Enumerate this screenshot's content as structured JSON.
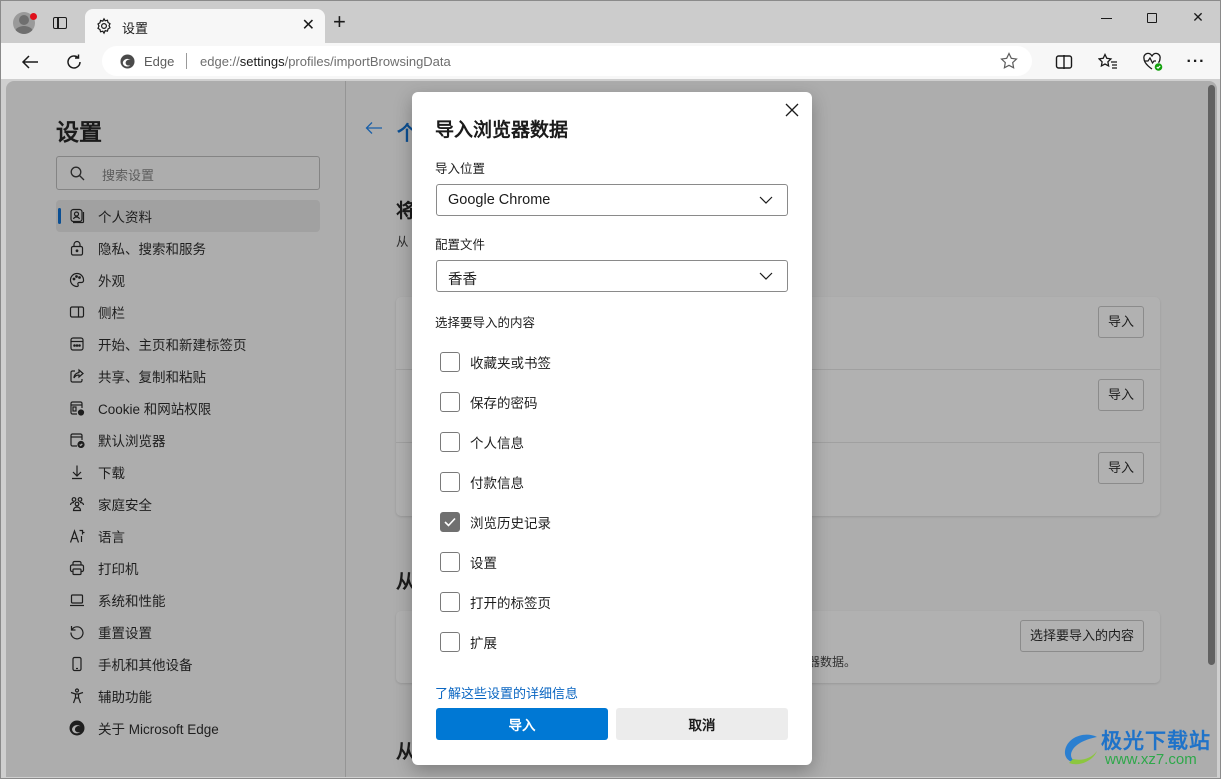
{
  "browser": {
    "tab_title": "设置",
    "address_label": "Edge",
    "url_prefix": "edge://",
    "url_host": "settings",
    "url_path": "/profiles/importBrowsingData",
    "profile_badge_color": "#e0101b"
  },
  "sidebar": {
    "title": "设置",
    "search_placeholder": "搜索设置",
    "items": [
      {
        "label": "个人资料",
        "icon": "profile-icon",
        "active": true
      },
      {
        "label": "隐私、搜索和服务",
        "icon": "lock-icon"
      },
      {
        "label": "外观",
        "icon": "palette-icon"
      },
      {
        "label": "侧栏",
        "icon": "sidebar-icon"
      },
      {
        "label": "开始、主页和新建标签页",
        "icon": "home-page-icon"
      },
      {
        "label": "共享、复制和粘贴",
        "icon": "share-icon"
      },
      {
        "label": "Cookie 和网站权限",
        "icon": "site-permissions-icon"
      },
      {
        "label": "默认浏览器",
        "icon": "default-browser-icon"
      },
      {
        "label": "下载",
        "icon": "download-icon"
      },
      {
        "label": "家庭安全",
        "icon": "family-icon"
      },
      {
        "label": "语言",
        "icon": "language-icon"
      },
      {
        "label": "打印机",
        "icon": "printer-icon"
      },
      {
        "label": "系统和性能",
        "icon": "laptop-icon"
      },
      {
        "label": "重置设置",
        "icon": "reset-icon"
      },
      {
        "label": "手机和其他设备",
        "icon": "phone-icon"
      },
      {
        "label": "辅助功能",
        "icon": "accessibility-icon"
      },
      {
        "label": "关于 Microsoft Edge",
        "icon": "edge-logo-icon"
      }
    ]
  },
  "content": {
    "title_partial": "个",
    "section1_heading_partial": "将",
    "section1_sub_partial": "从",
    "import_buttons": [
      "导入",
      "导入",
      "导入"
    ],
    "section2_heading_partial": "从",
    "section2_button": "选择要导入的内容",
    "section2_text_partial": "览器数据。",
    "section3_heading_partial": "从"
  },
  "dialog": {
    "title": "导入浏览器数据",
    "source_label": "导入位置",
    "source_value": "Google Chrome",
    "profile_label": "配置文件",
    "profile_value": "香香",
    "choose_label": "选择要导入的内容",
    "options": [
      {
        "label": "收藏夹或书签",
        "checked": false
      },
      {
        "label": "保存的密码",
        "checked": false
      },
      {
        "label": "个人信息",
        "checked": false
      },
      {
        "label": "付款信息",
        "checked": false
      },
      {
        "label": "浏览历史记录",
        "checked": true
      },
      {
        "label": "设置",
        "checked": false
      },
      {
        "label": "打开的标签页",
        "checked": false
      },
      {
        "label": "扩展",
        "checked": false
      }
    ],
    "learn_more_link": "了解这些设置的详细信息",
    "import_button": "导入",
    "cancel_button": "取消",
    "accent_color": "#0078d4"
  },
  "watermark": {
    "name": "极光下载站",
    "url": "www.xz7.com"
  }
}
